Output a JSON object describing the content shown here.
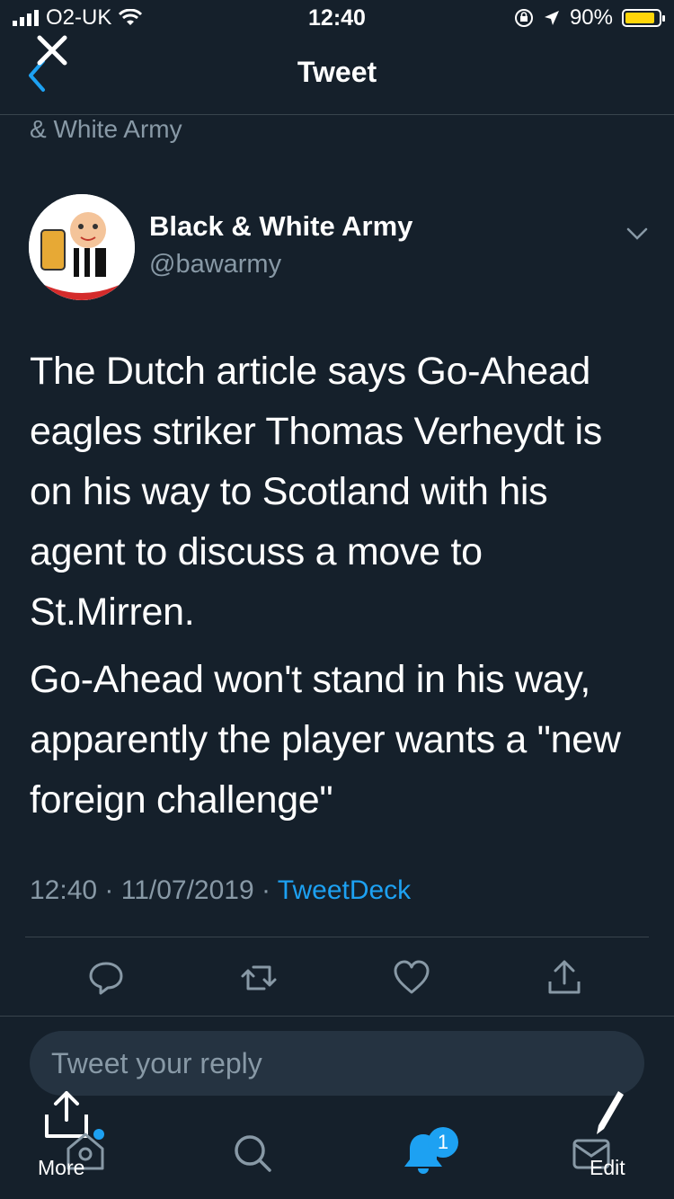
{
  "status_bar": {
    "carrier": "O2-UK",
    "time": "12:40",
    "battery": "90%"
  },
  "header": {
    "title": "Tweet"
  },
  "context": "& White Army",
  "author": {
    "name": "Black & White Army",
    "handle": "@bawarmy"
  },
  "tweet": {
    "paragraphs": [
      "The Dutch article says Go-Ahead eagles striker Thomas Verheydt is on his way to Scotland with his agent to discuss a move to St.Mirren.",
      "Go-Ahead won't stand in his way, apparently the player wants a \"new foreign challenge\""
    ],
    "time": "12:40",
    "date": "11/07/2019",
    "source": "TweetDeck",
    "separator": " · "
  },
  "reply": {
    "placeholder": "Tweet your reply"
  },
  "bottom_nav": {
    "notifications_count": "1",
    "more_label": "More",
    "edit_label": "Edit"
  },
  "colors": {
    "background": "#15202b",
    "accent": "#1da1f2",
    "muted": "#8899a6",
    "divider": "#38444d"
  },
  "icons": [
    "close-icon",
    "back-chevron-icon",
    "chevron-down-icon",
    "reply-icon",
    "retweet-icon",
    "like-icon",
    "share-icon",
    "home-icon",
    "search-icon",
    "notifications-icon",
    "messages-icon",
    "upload-icon",
    "pencil-icon"
  ]
}
